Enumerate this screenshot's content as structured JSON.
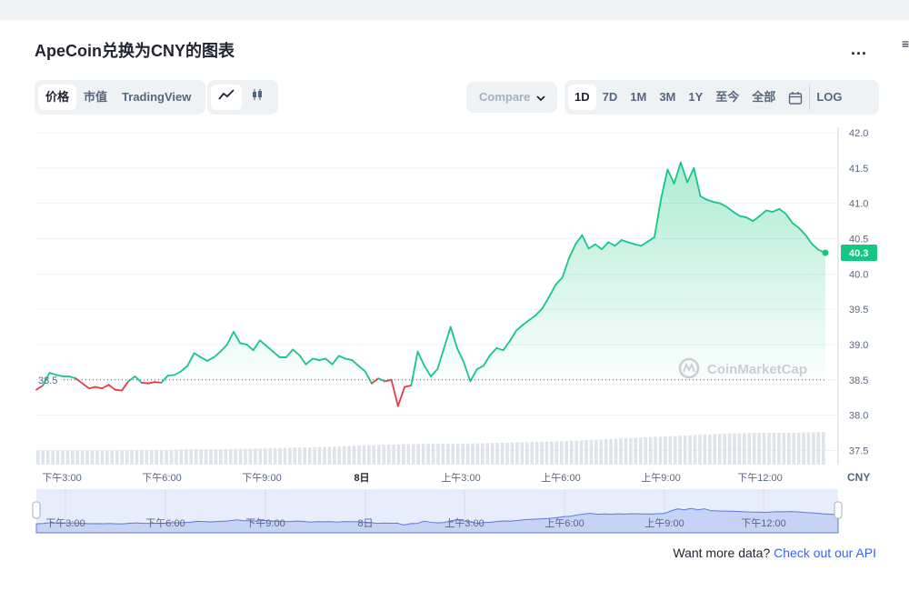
{
  "title": "ApeCoin兑换为CNY的图表",
  "more_label": "...",
  "edge_mark": "≡",
  "chart_types": [
    {
      "label": "价格",
      "active": true
    },
    {
      "label": "市值",
      "active": false
    },
    {
      "label": "TradingView",
      "active": false
    }
  ],
  "style_icons": [
    "line-chart-icon",
    "candlestick-icon"
  ],
  "compare": {
    "label": "Compare",
    "icon": "chevron-down-icon"
  },
  "ranges": [
    {
      "label": "1D",
      "active": true
    },
    {
      "label": "7D",
      "active": false
    },
    {
      "label": "1M",
      "active": false
    },
    {
      "label": "3M",
      "active": false
    },
    {
      "label": "1Y",
      "active": false
    },
    {
      "label": "至今",
      "active": false
    },
    {
      "label": "全部",
      "active": false
    }
  ],
  "calendar_icon": "calendar-icon",
  "log_label": "LOG",
  "currency_label": "CNY",
  "watermark": "CoinMarketCap",
  "footer": {
    "text": "Want more data? ",
    "link": "Check out our API"
  },
  "colors": {
    "up": "#16c784",
    "down": "#ea3943",
    "accent": "#3861fb"
  },
  "chart_data": {
    "type": "area",
    "ylim": [
      37.3,
      42.0
    ],
    "yticks": [
      37.5,
      38.0,
      38.5,
      39.0,
      39.5,
      40.0,
      40.5,
      41.0,
      41.5,
      42.0
    ],
    "open_price": 38.5,
    "open_label": "38.5",
    "current_price": 40.3,
    "current_label": "40.3",
    "xticks": [
      "下午3:00",
      "下午6:00",
      "下午9:00",
      "8日",
      "上午3:00",
      "上午6:00",
      "上午9:00",
      "下午12:00"
    ],
    "navigator_ticks": [
      "下午3:00",
      "下午6:00",
      "下午9:00",
      "8日",
      "上午3:00",
      "上午6:00",
      "上午9:00",
      "下午12:00"
    ],
    "x_range": [
      0,
      24
    ],
    "prices": [
      [
        0.0,
        38.36
      ],
      [
        0.2,
        38.42
      ],
      [
        0.4,
        38.6
      ],
      [
        0.6,
        38.57
      ],
      [
        0.8,
        38.55
      ],
      [
        1.0,
        38.55
      ],
      [
        1.2,
        38.52
      ],
      [
        1.4,
        38.45
      ],
      [
        1.6,
        38.38
      ],
      [
        1.8,
        38.4
      ],
      [
        2.0,
        38.38
      ],
      [
        2.2,
        38.43
      ],
      [
        2.4,
        38.36
      ],
      [
        2.6,
        38.35
      ],
      [
        2.8,
        38.48
      ],
      [
        3.0,
        38.55
      ],
      [
        3.2,
        38.46
      ],
      [
        3.4,
        38.45
      ],
      [
        3.6,
        38.47
      ],
      [
        3.8,
        38.46
      ],
      [
        4.0,
        38.56
      ],
      [
        4.2,
        38.57
      ],
      [
        4.4,
        38.62
      ],
      [
        4.6,
        38.7
      ],
      [
        4.8,
        38.88
      ],
      [
        5.0,
        38.82
      ],
      [
        5.2,
        38.77
      ],
      [
        5.4,
        38.82
      ],
      [
        5.6,
        38.9
      ],
      [
        5.8,
        39.0
      ],
      [
        6.0,
        39.18
      ],
      [
        6.2,
        39.02
      ],
      [
        6.4,
        39.0
      ],
      [
        6.6,
        38.92
      ],
      [
        6.8,
        39.06
      ],
      [
        7.0,
        38.98
      ],
      [
        7.2,
        38.9
      ],
      [
        7.4,
        38.82
      ],
      [
        7.6,
        38.82
      ],
      [
        7.8,
        38.93
      ],
      [
        8.0,
        38.85
      ],
      [
        8.2,
        38.72
      ],
      [
        8.4,
        38.8
      ],
      [
        8.6,
        38.78
      ],
      [
        8.8,
        38.8
      ],
      [
        9.0,
        38.72
      ],
      [
        9.2,
        38.84
      ],
      [
        9.4,
        38.8
      ],
      [
        9.6,
        38.78
      ],
      [
        9.8,
        38.7
      ],
      [
        10.0,
        38.62
      ],
      [
        10.2,
        38.45
      ],
      [
        10.4,
        38.52
      ],
      [
        10.6,
        38.48
      ],
      [
        10.8,
        38.5
      ],
      [
        11.0,
        38.13
      ],
      [
        11.2,
        38.4
      ],
      [
        11.4,
        38.42
      ],
      [
        11.6,
        38.9
      ],
      [
        11.8,
        38.7
      ],
      [
        12.0,
        38.55
      ],
      [
        12.2,
        38.65
      ],
      [
        12.4,
        38.95
      ],
      [
        12.6,
        39.25
      ],
      [
        12.8,
        38.95
      ],
      [
        13.0,
        38.75
      ],
      [
        13.2,
        38.48
      ],
      [
        13.4,
        38.65
      ],
      [
        13.6,
        38.7
      ],
      [
        13.8,
        38.85
      ],
      [
        14.0,
        38.95
      ],
      [
        14.2,
        38.92
      ],
      [
        14.4,
        39.05
      ],
      [
        14.6,
        39.2
      ],
      [
        14.8,
        39.28
      ],
      [
        15.0,
        39.35
      ],
      [
        15.2,
        39.42
      ],
      [
        15.4,
        39.52
      ],
      [
        15.6,
        39.68
      ],
      [
        15.8,
        39.85
      ],
      [
        16.0,
        39.95
      ],
      [
        16.2,
        40.22
      ],
      [
        16.4,
        40.42
      ],
      [
        16.6,
        40.55
      ],
      [
        16.8,
        40.36
      ],
      [
        17.0,
        40.42
      ],
      [
        17.2,
        40.35
      ],
      [
        17.4,
        40.45
      ],
      [
        17.6,
        40.4
      ],
      [
        17.8,
        40.48
      ],
      [
        18.0,
        40.45
      ],
      [
        18.2,
        40.42
      ],
      [
        18.4,
        40.4
      ],
      [
        18.6,
        40.46
      ],
      [
        18.8,
        40.52
      ],
      [
        19.0,
        41.06
      ],
      [
        19.2,
        41.48
      ],
      [
        19.4,
        41.28
      ],
      [
        19.6,
        41.58
      ],
      [
        19.8,
        41.3
      ],
      [
        20.0,
        41.5
      ],
      [
        20.2,
        41.1
      ],
      [
        20.4,
        41.05
      ],
      [
        20.6,
        41.02
      ],
      [
        20.8,
        41.0
      ],
      [
        21.0,
        40.95
      ],
      [
        21.2,
        40.88
      ],
      [
        21.4,
        40.82
      ],
      [
        21.6,
        40.8
      ],
      [
        21.8,
        40.75
      ],
      [
        22.0,
        40.82
      ],
      [
        22.2,
        40.9
      ],
      [
        22.4,
        40.88
      ],
      [
        22.6,
        40.92
      ],
      [
        22.8,
        40.85
      ],
      [
        23.0,
        40.72
      ],
      [
        23.2,
        40.65
      ],
      [
        23.4,
        40.55
      ],
      [
        23.6,
        40.42
      ],
      [
        23.8,
        40.34
      ],
      [
        24.0,
        40.3
      ]
    ],
    "volume": [
      0.18,
      0.18,
      0.18,
      0.19,
      0.19,
      0.2,
      0.2,
      0.21,
      0.22,
      0.23,
      0.25,
      0.26,
      0.27,
      0.27,
      0.28,
      0.29,
      0.3,
      0.32,
      0.34,
      0.36,
      0.38,
      0.4,
      0.41,
      0.41,
      0.42
    ]
  }
}
